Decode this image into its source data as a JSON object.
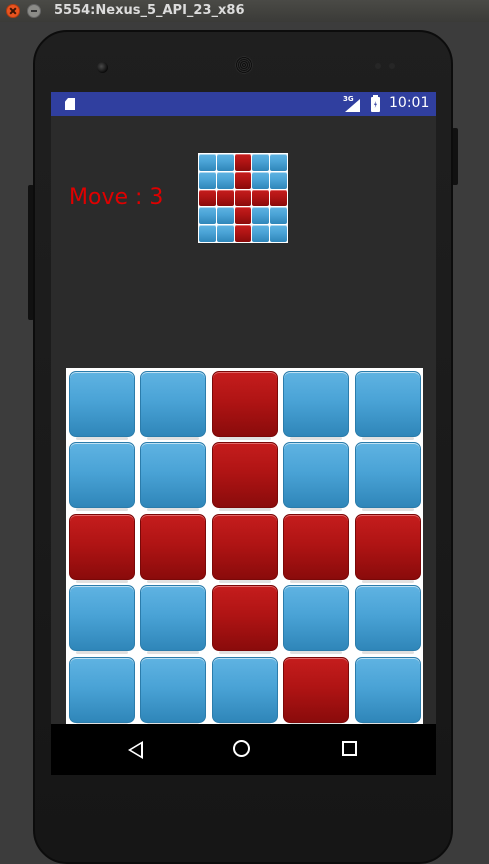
{
  "window": {
    "title": "5554:Nexus_5_API_23_x86"
  },
  "statusbar": {
    "network_label": "3G",
    "time": "10:01",
    "icons": [
      "sd-card-icon",
      "signal-icon",
      "battery-charging-icon"
    ]
  },
  "game": {
    "move_label": "Move : 3",
    "target_grid": [
      [
        "blue",
        "blue",
        "red",
        "blue",
        "blue"
      ],
      [
        "blue",
        "blue",
        "red",
        "blue",
        "blue"
      ],
      [
        "red",
        "red",
        "red",
        "red",
        "red"
      ],
      [
        "blue",
        "blue",
        "red",
        "blue",
        "blue"
      ],
      [
        "blue",
        "blue",
        "red",
        "blue",
        "blue"
      ]
    ],
    "board": [
      [
        "blue",
        "blue",
        "red",
        "blue",
        "blue"
      ],
      [
        "blue",
        "blue",
        "red",
        "blue",
        "blue"
      ],
      [
        "red",
        "red",
        "red",
        "red",
        "red"
      ],
      [
        "blue",
        "blue",
        "red",
        "blue",
        "blue"
      ],
      [
        "blue",
        "blue",
        "blue",
        "red",
        "blue"
      ]
    ],
    "colors": {
      "blue": "#4aa3d6",
      "red": "#b01414",
      "move_text": "#e00000"
    }
  },
  "navbar": {
    "icons": [
      "back-icon",
      "home-icon",
      "recent-apps-icon"
    ]
  }
}
